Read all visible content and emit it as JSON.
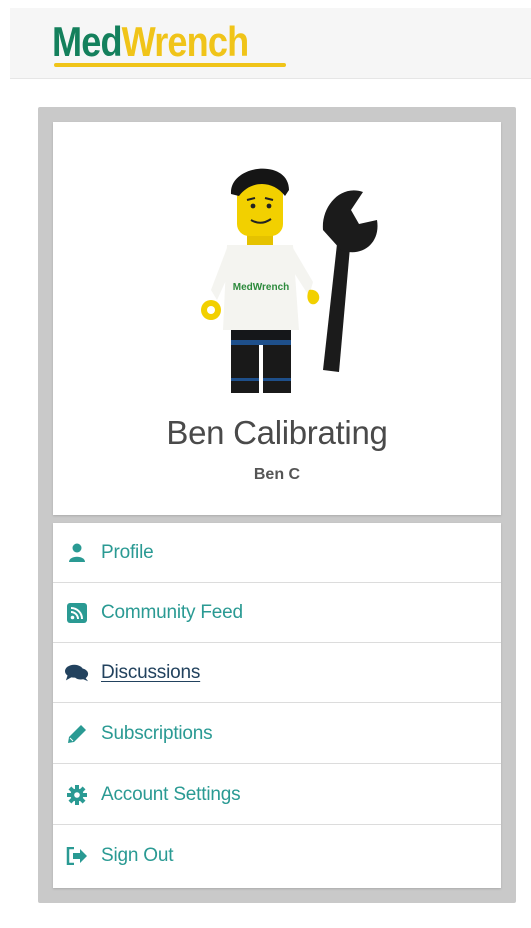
{
  "brand": {
    "logo_part1": "Med",
    "logo_part2": "Wrench",
    "color_primary": "#14805c",
    "color_accent": "#f0c419"
  },
  "profile": {
    "name": "Ben Calibrating",
    "handle": "Ben C",
    "avatar_shirt_text": "MedWrench"
  },
  "menu": {
    "accent_color": "#2a9a93",
    "items": [
      {
        "label": "Profile",
        "icon": "user-icon"
      },
      {
        "label": "Community Feed",
        "icon": "rss-icon"
      },
      {
        "label": "Discussions",
        "icon": "comments-icon"
      },
      {
        "label": "Subscriptions",
        "icon": "pencil-icon"
      },
      {
        "label": "Account Settings",
        "icon": "gear-icon"
      },
      {
        "label": "Sign Out",
        "icon": "sign-out-icon"
      }
    ]
  }
}
